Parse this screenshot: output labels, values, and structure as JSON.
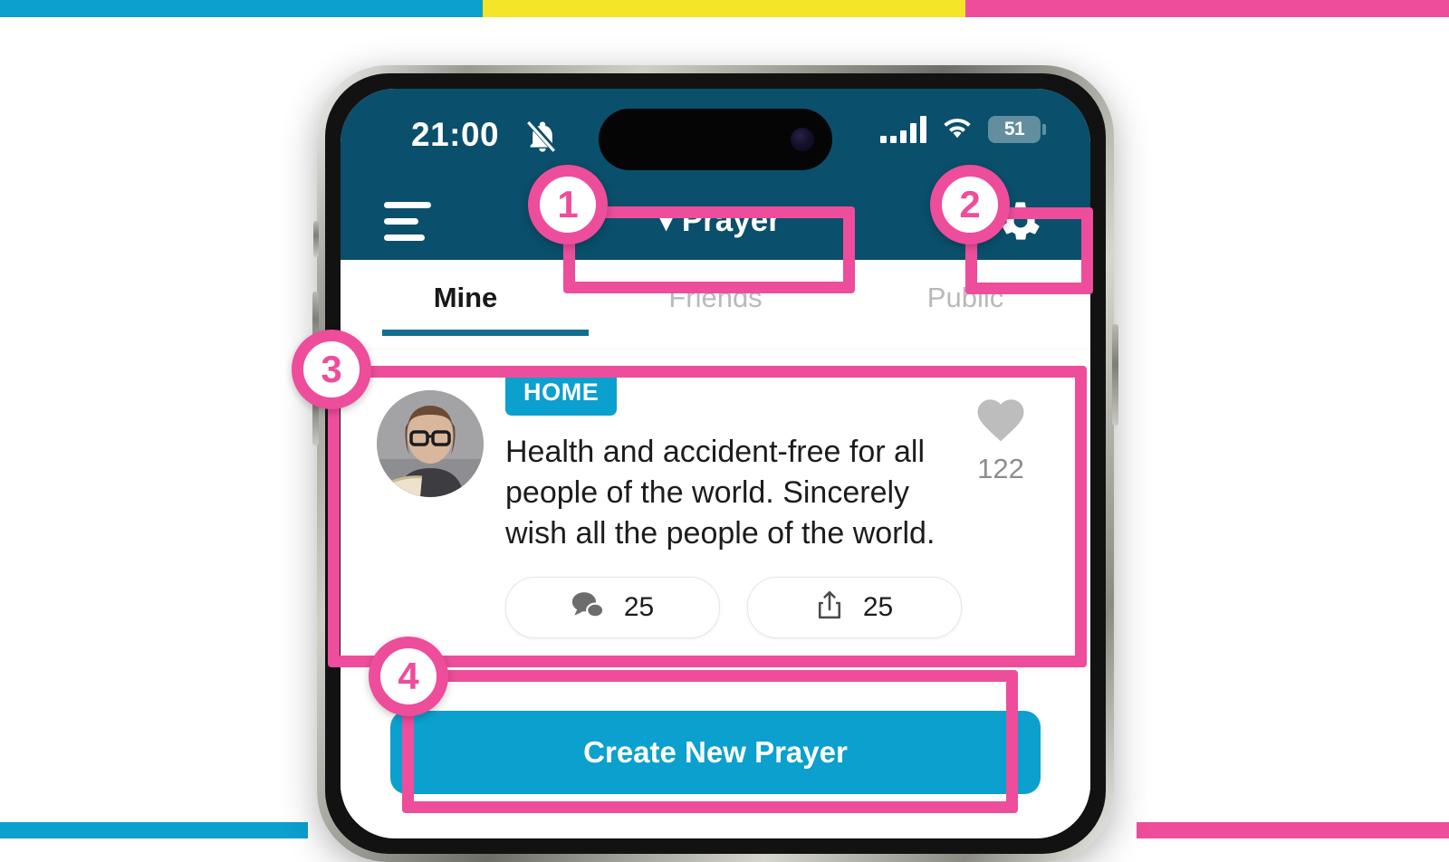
{
  "decor": {
    "top_bars": [
      {
        "name": "cyan",
        "color": "#0BA0CE"
      },
      {
        "name": "yellow",
        "color": "#F4E528"
      },
      {
        "name": "pink",
        "color": "#ED4D9B"
      }
    ],
    "bottom_bars": [
      {
        "name": "cyan",
        "color": "#0BA0CE"
      },
      {
        "name": "pink",
        "color": "#ED4D9B"
      }
    ],
    "accent_pink": "#ED4D9B",
    "accent_cyan": "#0BA0CE",
    "header_teal": "#0A4F6B"
  },
  "status_bar": {
    "time": "21:00",
    "mute_icon": "bell-slash-icon",
    "signal_icon": "cellular-signal-icon",
    "wifi_icon": "wifi-icon",
    "battery_level": "51",
    "battery_icon": "battery-icon"
  },
  "header": {
    "menu_icon": "hamburger-menu-icon",
    "title": "▼Prayer",
    "title_text": "Prayer",
    "settings_icon": "gear-icon"
  },
  "tabs": [
    {
      "label": "Mine",
      "active": true
    },
    {
      "label": "Friends",
      "active": false
    },
    {
      "label": "Public",
      "active": false
    }
  ],
  "card": {
    "avatar_alt": "woman-reading-book-avatar",
    "badge": "HOME",
    "text": "Health and accident-free for all people of the world. Sincerely wish all the people of the world.",
    "like": {
      "icon": "heart-icon",
      "count": "122"
    },
    "actions": [
      {
        "icon": "comment-icon",
        "count": "25"
      },
      {
        "icon": "share-icon",
        "count": "25"
      }
    ]
  },
  "cta": {
    "label": "Create New Prayer"
  },
  "annotations": [
    {
      "number": "1",
      "target": "header-title"
    },
    {
      "number": "2",
      "target": "settings-gear"
    },
    {
      "number": "3",
      "target": "prayer-card"
    },
    {
      "number": "4",
      "target": "create-prayer-button"
    }
  ]
}
